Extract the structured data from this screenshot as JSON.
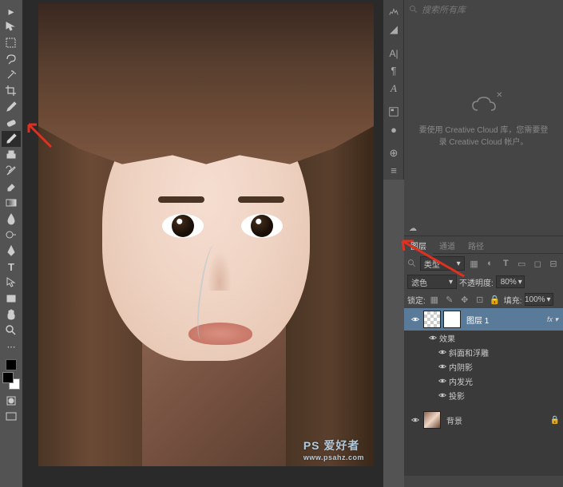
{
  "tools": [
    {
      "name": "move-tool",
      "icon": "move"
    },
    {
      "name": "marquee-tool",
      "icon": "marquee"
    },
    {
      "name": "lasso-tool",
      "icon": "lasso"
    },
    {
      "name": "magic-wand-tool",
      "icon": "wand"
    },
    {
      "name": "crop-tool",
      "icon": "crop"
    },
    {
      "name": "eyedropper-tool",
      "icon": "eyedropper"
    },
    {
      "name": "healing-brush-tool",
      "icon": "bandaid"
    },
    {
      "name": "brush-tool",
      "icon": "brush",
      "active": true
    },
    {
      "name": "clone-stamp-tool",
      "icon": "stamp"
    },
    {
      "name": "history-brush-tool",
      "icon": "historybrush"
    },
    {
      "name": "eraser-tool",
      "icon": "eraser"
    },
    {
      "name": "gradient-tool",
      "icon": "gradient"
    },
    {
      "name": "blur-tool",
      "icon": "blur"
    },
    {
      "name": "dodge-tool",
      "icon": "dodge"
    },
    {
      "name": "pen-tool",
      "icon": "pen"
    },
    {
      "name": "type-tool",
      "icon": "type"
    },
    {
      "name": "path-selection-tool",
      "icon": "pathsel"
    },
    {
      "name": "rectangle-tool",
      "icon": "rect"
    },
    {
      "name": "hand-tool",
      "icon": "hand"
    },
    {
      "name": "zoom-tool",
      "icon": "zoom"
    }
  ],
  "search": {
    "placeholder": "搜索所有库"
  },
  "cc": {
    "line1": "要使用 Creative Cloud 库，您需要登",
    "line2": "录 Creative Cloud 帐户。"
  },
  "layers_panel": {
    "tabs": [
      "图层",
      "通道",
      "路径"
    ],
    "active_tab": "图层",
    "filter_label": "类型",
    "blend_mode": "滤色",
    "opacity_label": "不透明度:",
    "opacity_value": "80%",
    "lock_label": "锁定:",
    "fill_label": "填充:",
    "fill_value": "100%"
  },
  "layers": [
    {
      "name": "图层 1",
      "selected": true,
      "fx": true
    },
    {
      "name": "背景",
      "selected": false,
      "fx": false
    }
  ],
  "effects": {
    "header": "效果",
    "items": [
      "斜面和浮雕",
      "内阴影",
      "内发光",
      "投影"
    ]
  },
  "watermark": {
    "main": "PS 爱好者",
    "sub": "www.psahz.com"
  }
}
